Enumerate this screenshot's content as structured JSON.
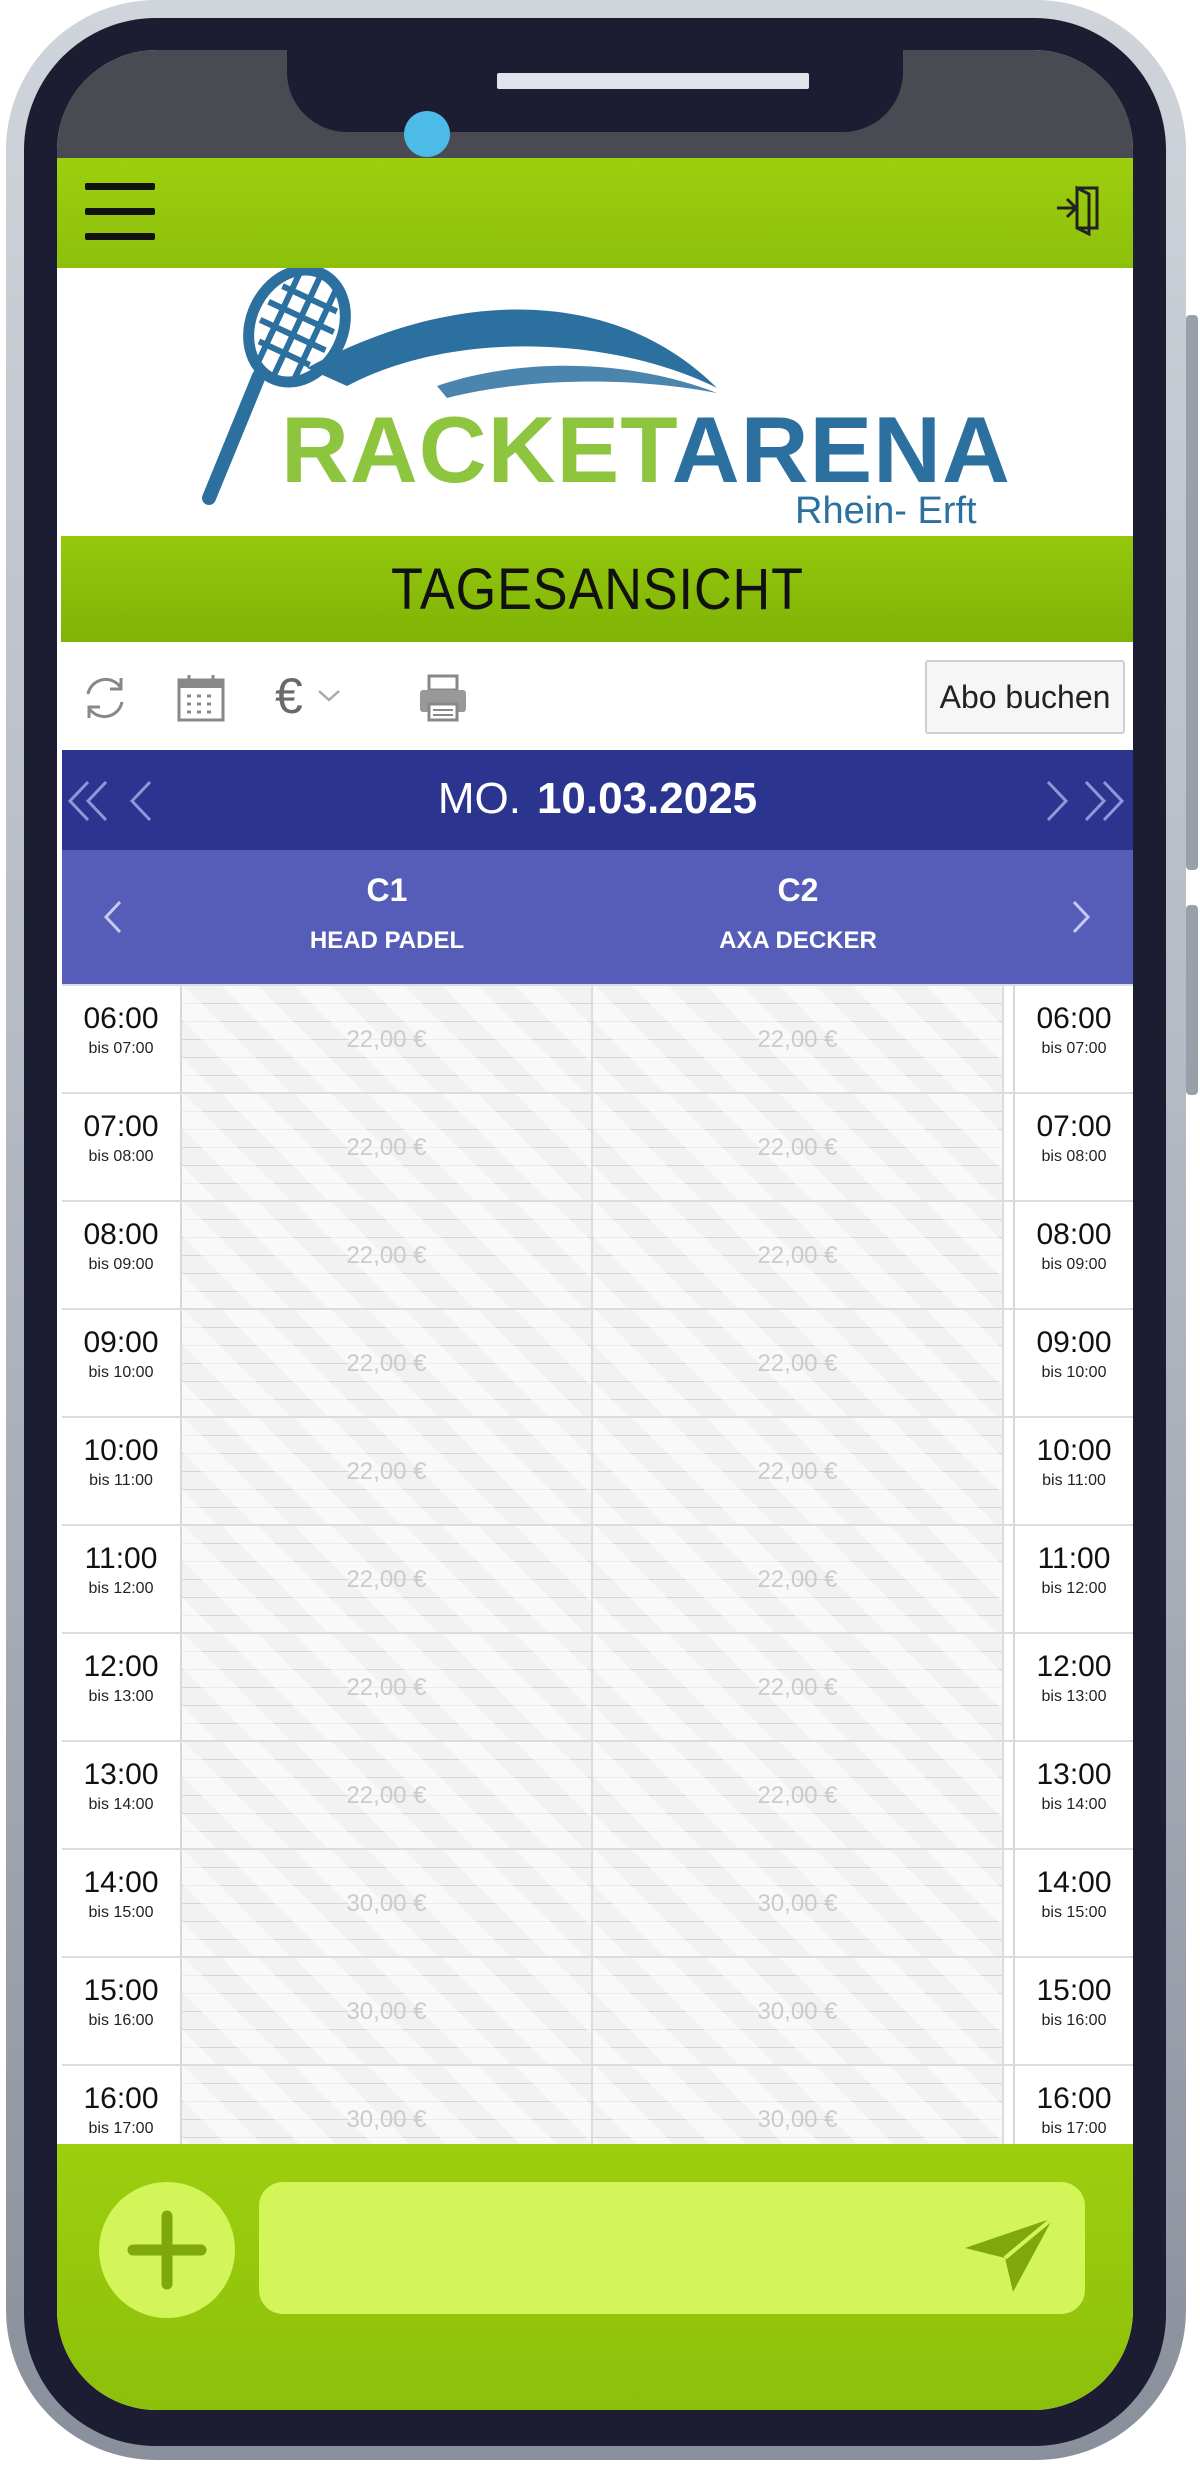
{
  "app": {
    "logo_word_1": "RACKET",
    "logo_word_2": "ARENA",
    "logo_sub": "Rhein- Erft",
    "page_title": "TAGESANSICHT",
    "brand_green": "#8cc00a",
    "nav_blue": "#2b3590",
    "court_blue": "#555db9"
  },
  "topbar": {
    "menu_icon": "hamburger-menu-icon",
    "logout_icon": "logout-icon"
  },
  "toolbar": {
    "refresh_icon": "refresh-icon",
    "calendar_icon": "calendar-icon",
    "currency_symbol": "€",
    "print_icon": "printer-icon",
    "abo_label": "Abo buchen"
  },
  "datebar": {
    "weekday": "MO.",
    "date": "10.03.2025"
  },
  "courts": [
    {
      "name": "C1",
      "sub": "HEAD PADEL"
    },
    {
      "name": "C2",
      "sub": "AXA DECKER"
    }
  ],
  "slots": [
    {
      "time": "06:00",
      "until": "bis 07:00",
      "c1": "22,00 €",
      "c2": "22,00 €"
    },
    {
      "time": "07:00",
      "until": "bis 08:00",
      "c1": "22,00 €",
      "c2": "22,00 €"
    },
    {
      "time": "08:00",
      "until": "bis 09:00",
      "c1": "22,00 €",
      "c2": "22,00 €"
    },
    {
      "time": "09:00",
      "until": "bis 10:00",
      "c1": "22,00 €",
      "c2": "22,00 €"
    },
    {
      "time": "10:00",
      "until": "bis 11:00",
      "c1": "22,00 €",
      "c2": "22,00 €"
    },
    {
      "time": "11:00",
      "until": "bis 12:00",
      "c1": "22,00 €",
      "c2": "22,00 €"
    },
    {
      "time": "12:00",
      "until": "bis 13:00",
      "c1": "22,00 €",
      "c2": "22,00 €"
    },
    {
      "time": "13:00",
      "until": "bis 14:00",
      "c1": "22,00 €",
      "c2": "22,00 €"
    },
    {
      "time": "14:00",
      "until": "bis 15:00",
      "c1": "30,00 €",
      "c2": "30,00 €"
    },
    {
      "time": "15:00",
      "until": "bis 16:00",
      "c1": "30,00 €",
      "c2": "30,00 €"
    },
    {
      "time": "16:00",
      "until": "bis 17:00",
      "c1": "30,00 €",
      "c2": "30,00 €"
    }
  ],
  "bottombar": {
    "add_icon": "plus-icon",
    "send_icon": "send-icon",
    "message_value": ""
  }
}
